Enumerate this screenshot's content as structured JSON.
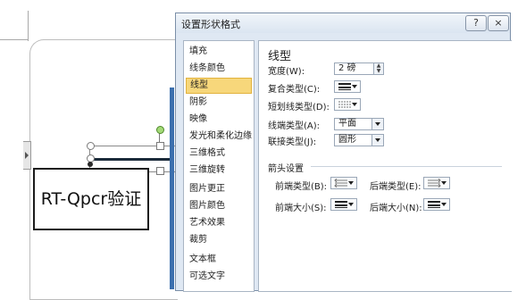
{
  "dialog": {
    "title": "设置形状格式",
    "help_label": "?",
    "close_label": "×"
  },
  "nav": {
    "items": [
      {
        "label": "填充"
      },
      {
        "label": "线条颜色"
      },
      {
        "label": "线型",
        "selected": true
      },
      {
        "label": "阴影"
      },
      {
        "label": "映像"
      },
      {
        "label": "发光和柔化边缘"
      },
      {
        "label": "三维格式"
      },
      {
        "label": "三维旋转"
      },
      {
        "label": "图片更正"
      },
      {
        "label": "图片颜色"
      },
      {
        "label": "艺术效果"
      },
      {
        "label": "裁剪"
      },
      {
        "label": "文本框"
      },
      {
        "label": "可选文字"
      }
    ]
  },
  "panel": {
    "title": "线型",
    "width_label": "宽度(W):",
    "width_value": "2 磅",
    "compound_label": "复合类型(C):",
    "dash_label": "短划线类型(D):",
    "cap_label": "线端类型(A):",
    "cap_value": "平面",
    "join_label": "联接类型(J):",
    "join_value": "圆形",
    "arrow_section": "箭头设置",
    "begin_type_label": "前端类型(B):",
    "end_type_label": "后端类型(E):",
    "begin_size_label": "前端大小(S):",
    "end_size_label": "后端大小(N):"
  },
  "canvas": {
    "textbox_text": "RT-Qpcr验证"
  },
  "icons": {
    "spin": "spin-arrows-icon",
    "line_style": "line-style-icon",
    "arrow_style": "arrow-style-icon"
  },
  "colors": {
    "selected_item": "#f7d77b",
    "dialog_bg": "#dfe8f3",
    "rotation_handle": "#a3d977"
  }
}
